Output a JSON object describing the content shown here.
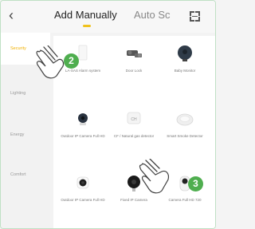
{
  "header": {
    "back_icon": "chevron-left-icon",
    "tabs": [
      {
        "label": "Add Manually",
        "active": true
      },
      {
        "label": "Auto Sc",
        "active": false
      }
    ],
    "scan_icon": "scan-icon",
    "accent": "#f0c21d"
  },
  "sidebar": {
    "items": [
      {
        "label": "Security",
        "active": true
      },
      {
        "label": "Lighting",
        "active": false
      },
      {
        "label": "Energy",
        "active": false
      },
      {
        "label": "Comfort",
        "active": false
      }
    ],
    "active_color": "#f0b000"
  },
  "devices": [
    {
      "label": "LA-SAS Alarm system",
      "icon": "alarm-system-icon"
    },
    {
      "label": "Door Lock",
      "icon": "door-lock-icon"
    },
    {
      "label": "Baby Monitor",
      "icon": "baby-monitor-icon"
    },
    {
      "label": "Outdoor IP Camera Full HD",
      "icon": "outdoor-camera-icon"
    },
    {
      "label": "CF / Natural gas detector",
      "icon": "gas-detector-icon"
    },
    {
      "label": "Smart Smoke Detector",
      "icon": "smoke-detector-icon"
    },
    {
      "label": "Outdoor IP Camera Full HD",
      "icon": "outdoor-camera-icon"
    },
    {
      "label": "Fixed IP Camera",
      "icon": "fixed-camera-icon"
    },
    {
      "label": "Camera Full HD 720",
      "icon": "pan-tilt-camera-icon"
    }
  ],
  "callouts": [
    {
      "number": "2",
      "icon": "tap-hand-icon"
    },
    {
      "number": "3",
      "icon": "tap-hand-icon"
    }
  ],
  "callout_color": "#4fae4f"
}
